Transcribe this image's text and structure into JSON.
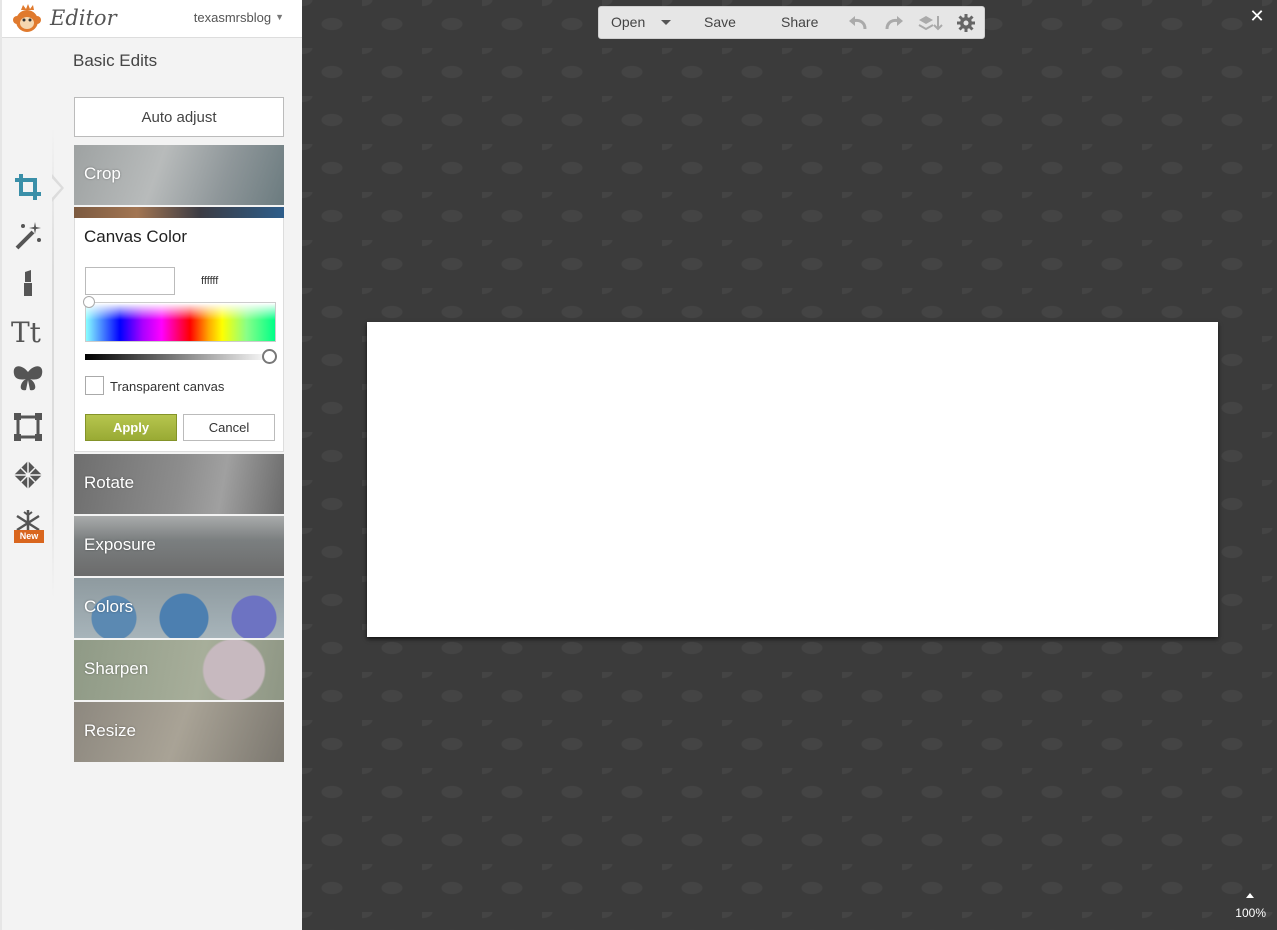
{
  "app": {
    "title": "Editor",
    "username": "texasmrsblog"
  },
  "panel": {
    "title": "Basic Edits",
    "auto_adjust_label": "Auto adjust"
  },
  "tools": {
    "crop": "Crop",
    "rotate": "Rotate",
    "exposure": "Exposure",
    "colors": "Colors",
    "sharpen": "Sharpen",
    "resize": "Resize"
  },
  "rail": {
    "new_badge": "New",
    "icons": [
      "crop-icon",
      "magic-wand-icon",
      "lipstick-icon",
      "text-icon",
      "butterfly-icon",
      "frame-icon",
      "texture-icon",
      "snowflake-icon"
    ]
  },
  "canvas_color": {
    "title": "Canvas Color",
    "hex_value": "ffffff",
    "transparent_label": "Transparent canvas",
    "transparent_checked": false,
    "apply_label": "Apply",
    "cancel_label": "Cancel"
  },
  "toolbar": {
    "open_label": "Open",
    "save_label": "Save",
    "share_label": "Share"
  },
  "workspace": {
    "close_label": "✕",
    "zoom": "100%"
  },
  "colors": {
    "accent_active": "#3a8fa8",
    "apply_green": "#a5b53f",
    "new_badge": "#d9661e",
    "workspace_bg": "#3b3b3b"
  }
}
